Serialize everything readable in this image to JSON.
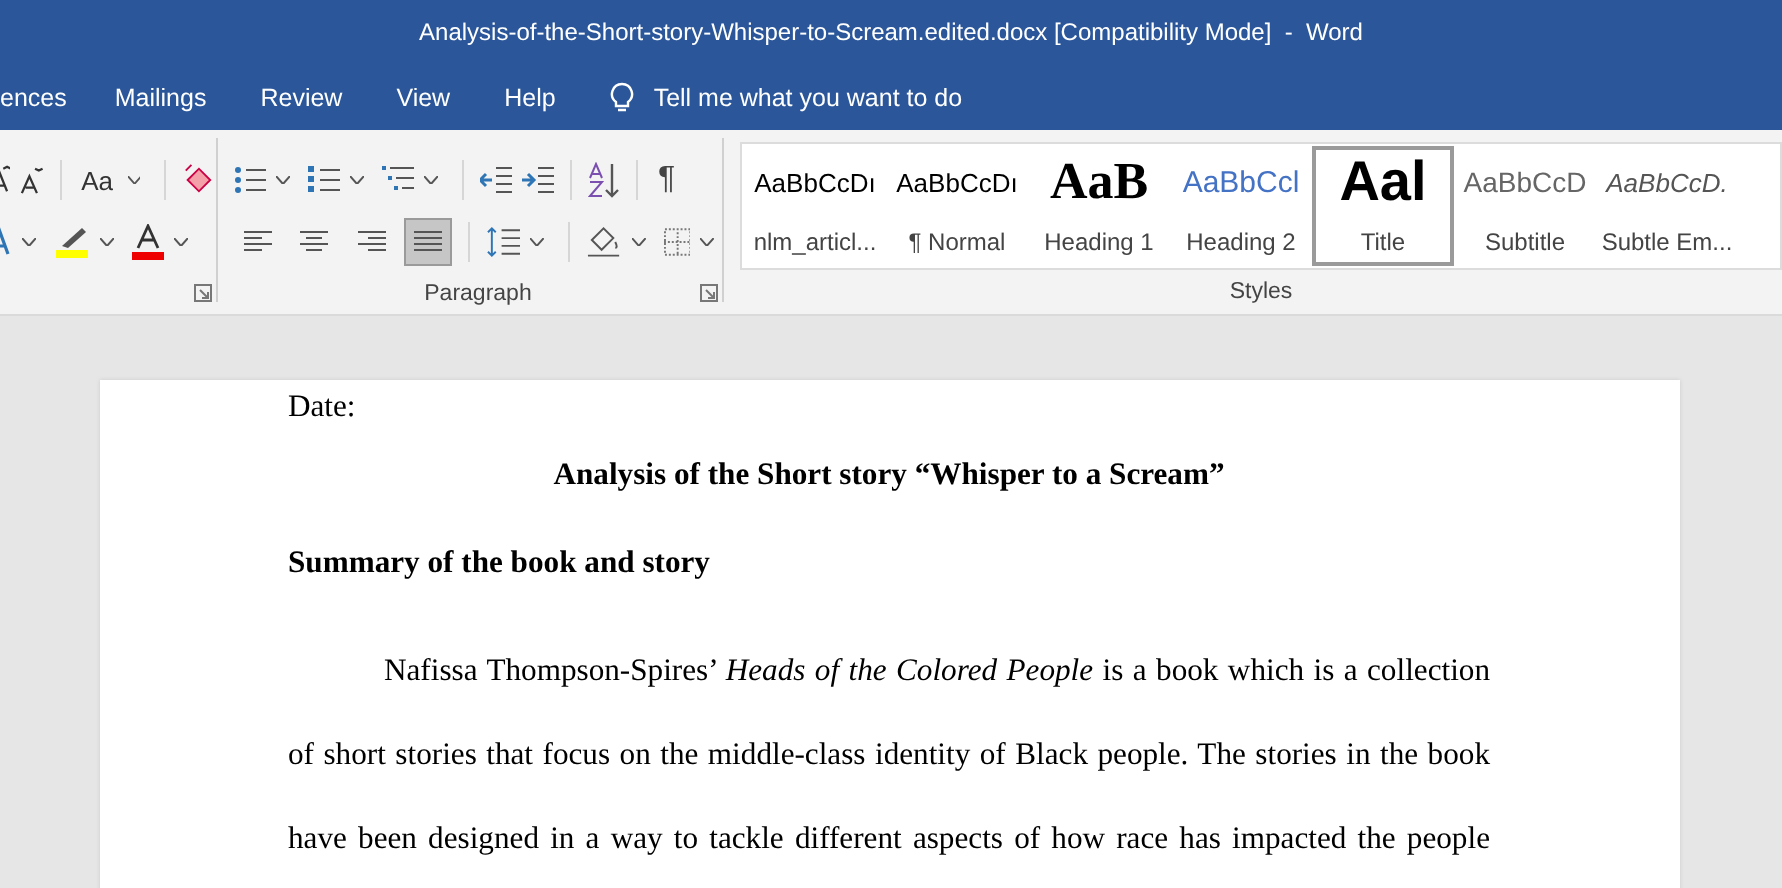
{
  "window": {
    "title": "Analysis-of-the-Short-story-Whisper-to-Scream.edited.docx [Compatibility Mode]  -  Word"
  },
  "tabs": [
    {
      "label": "ences",
      "selected": false
    },
    {
      "label": "Mailings",
      "selected": false
    },
    {
      "label": "Review",
      "selected": false
    },
    {
      "label": "View",
      "selected": false
    },
    {
      "label": "Help",
      "selected": false
    }
  ],
  "tell_me": {
    "placeholder": "Tell me what you want to do"
  },
  "font_group": {
    "change_case": "Aa"
  },
  "paragraph_group": {
    "label": "Paragraph",
    "show_marks": "¶",
    "alignments": [
      {
        "kind": "left",
        "selected": false
      },
      {
        "kind": "center",
        "selected": false
      },
      {
        "kind": "right",
        "selected": false
      },
      {
        "kind": "justify",
        "selected": true
      }
    ]
  },
  "styles_group": {
    "label": "Styles",
    "styles": [
      {
        "kind": "plain",
        "preview": "AaBbCcDı",
        "label": "nlm_articl...",
        "selected": false
      },
      {
        "kind": "plain",
        "preview": "AaBbCcDı",
        "label": "¶ Normal",
        "selected": false
      },
      {
        "kind": "heading1",
        "preview": "AaB",
        "label": "Heading 1",
        "selected": false
      },
      {
        "kind": "heading2",
        "preview": "AaBbCcl",
        "label": "Heading 2",
        "selected": false
      },
      {
        "kind": "title",
        "preview": "Aal",
        "label": "Title",
        "selected": true
      },
      {
        "kind": "subtitle",
        "preview": "AaBbCcD",
        "label": "Subtitle",
        "selected": false
      },
      {
        "kind": "emphasis",
        "preview": "AaBbCcD.",
        "label": "Subtle Em...",
        "selected": false
      }
    ]
  },
  "document": {
    "date_line": "Date:",
    "title": "Analysis of the Short story “Whisper to a Scream”",
    "heading": "Summary of the book and story",
    "paragraph": "Nafissa Thompson-Spires’ *Heads of the Colored People* is a book which is a collection of short stories that focus on the middle-class identity of Black people. The stories in the book have been designed in a way to tackle different aspects of how race has impacted the people"
  }
}
